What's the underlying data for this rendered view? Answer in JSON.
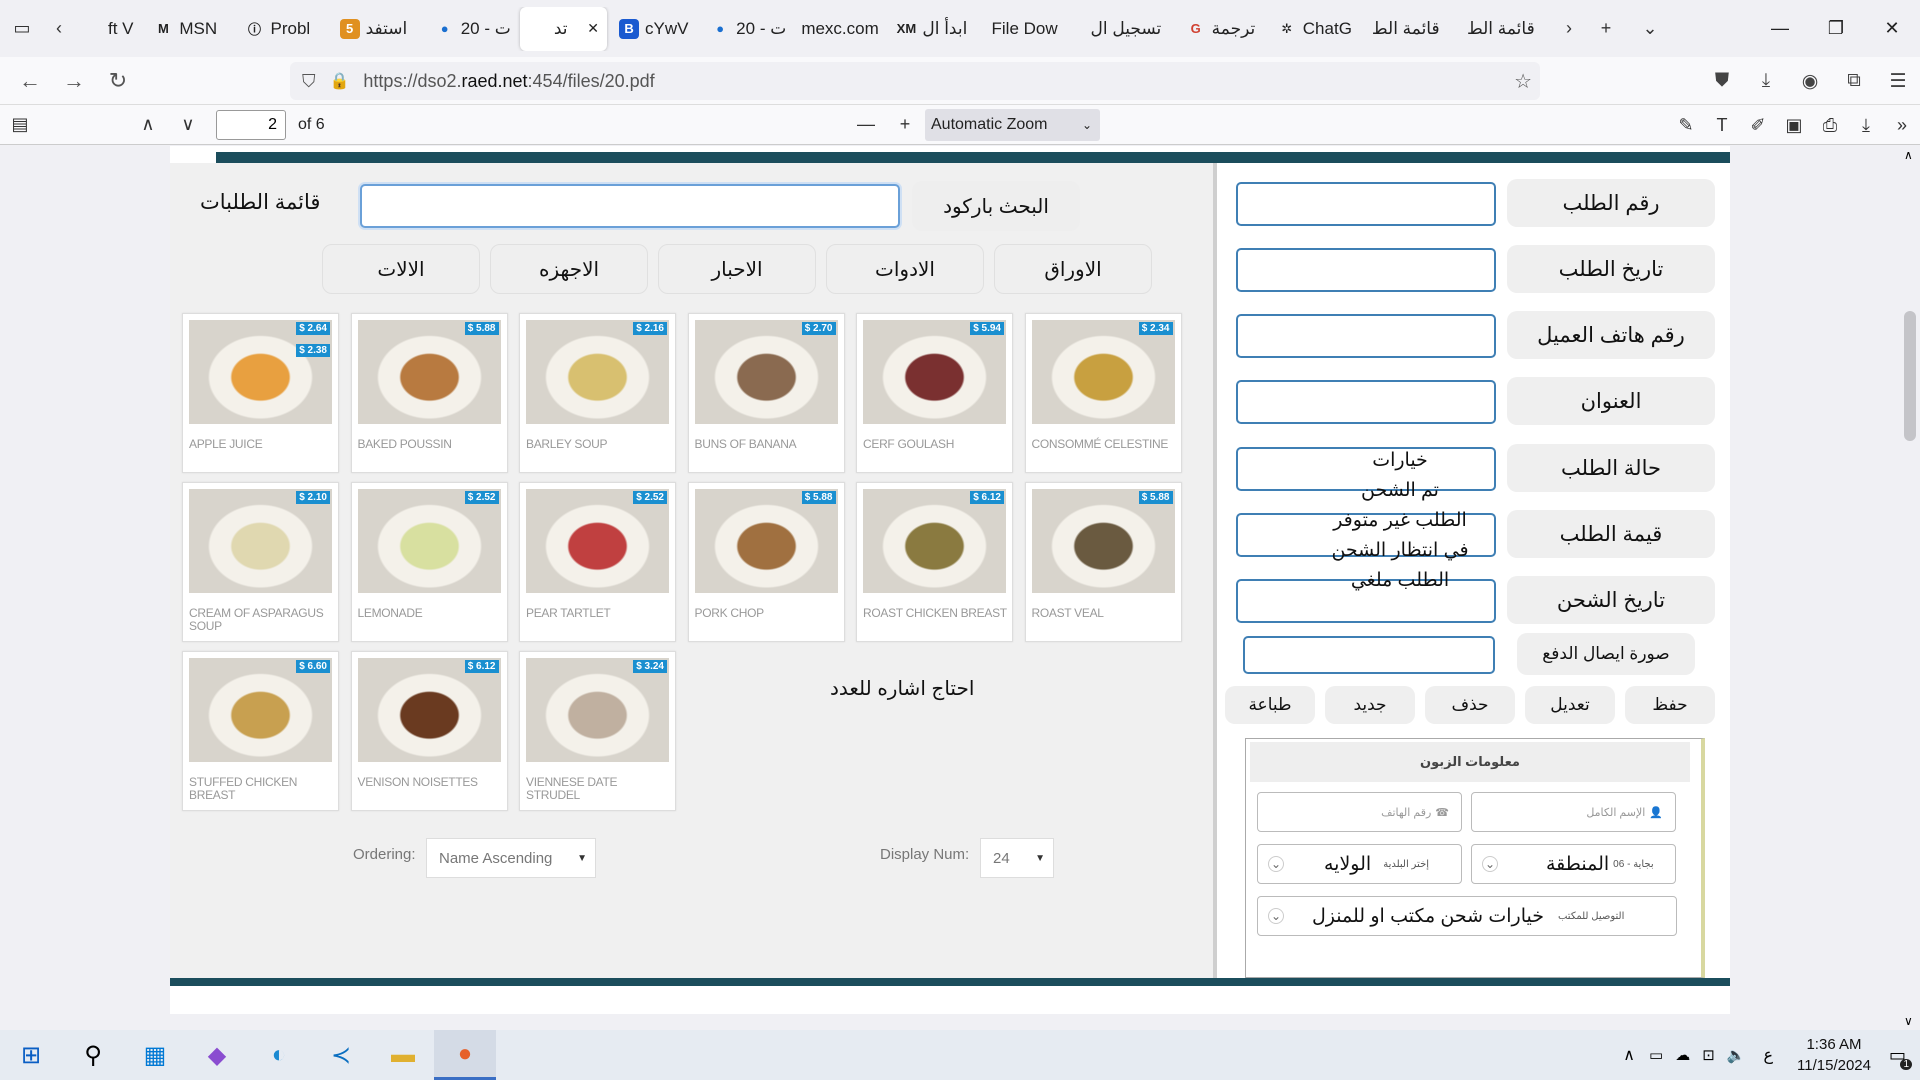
{
  "browser": {
    "tabs": [
      {
        "label": "ft V",
        "icon": "page-icon"
      },
      {
        "label": "MSN",
        "icon": "msn-icon"
      },
      {
        "label": "Probl",
        "icon": "info-icon"
      },
      {
        "label": "استفد",
        "icon": "number-5-icon"
      },
      {
        "label": "ت - 20",
        "icon": "cloud-icon"
      },
      {
        "label": "تد",
        "icon": "page-icon",
        "active": true
      },
      {
        "label": "cYwV",
        "icon": "b-icon"
      },
      {
        "label": "ت - 20",
        "icon": "cloud-icon"
      },
      {
        "label": "mexc.com",
        "icon": ""
      },
      {
        "label": "ابدأ ال",
        "icon": "xm-icon"
      },
      {
        "label": "File Dow",
        "icon": ""
      },
      {
        "label": "تسجيل ال",
        "icon": ""
      },
      {
        "label": "ترجمة",
        "icon": "google-icon"
      },
      {
        "label": "ChatG",
        "icon": "chatgpt-icon"
      },
      {
        "label": "قائمة الط",
        "icon": ""
      },
      {
        "label": "قائمة الط",
        "icon": ""
      }
    ],
    "url_prefix": "https://dso2.",
    "url_domain": "raed.net",
    "url_suffix": ":454/files/20.pdf"
  },
  "pdf_toolbar": {
    "page_number": "2",
    "page_count": "of 6",
    "zoom": "Automatic Zoom"
  },
  "form": {
    "list_title": "قائمة الطلبات",
    "barcode_search": "البحث باركود",
    "categories": [
      "الاوراق",
      "الادوات",
      "الاحبار",
      "الاجهزه",
      "الالات"
    ],
    "fields": [
      "رقم الطلب",
      "تاريخ الطلب",
      "رقم هاتف العميل",
      "العنوان",
      "حالة الطلب",
      "قيمة الطلب",
      "تاريخ الشحن",
      "صورة ايصال الدفع"
    ],
    "status_options": [
      "خيارات",
      "تم الشحن",
      "الطلب غير متوفر",
      "في انتظار الشحن",
      "الطلب ملغي"
    ],
    "actions": [
      "حفظ",
      "تعديل",
      "حذف",
      "جديد",
      "طباعة"
    ],
    "count_note": "احتاج اشاره للعدد"
  },
  "products": [
    {
      "name": "APPLE JUICE",
      "price": "$ 2.64",
      "price2": "$ 2.38",
      "color": "#e8a040"
    },
    {
      "name": "BAKED POUSSIN",
      "price": "$ 5.88",
      "color": "#b87a40"
    },
    {
      "name": "BARLEY SOUP",
      "price": "$ 2.16",
      "color": "#d8c070"
    },
    {
      "name": "BUNS OF BANANA",
      "price": "$ 2.70",
      "color": "#8a6a50"
    },
    {
      "name": "CERF GOULASH",
      "price": "$ 5.94",
      "color": "#7a3030"
    },
    {
      "name": "CONSOMMÉ CELESTINE",
      "price": "$ 2.34",
      "color": "#c8a040"
    },
    {
      "name": "CREAM OF ASPARAGUS SOUP",
      "price": "$ 2.10",
      "color": "#e0d8b0"
    },
    {
      "name": "LEMONADE",
      "price": "$ 2.52",
      "color": "#d8e0a0"
    },
    {
      "name": "PEAR TARTLET",
      "price": "$ 2.52",
      "color": "#c04040"
    },
    {
      "name": "PORK CHOP",
      "price": "$ 5.88",
      "color": "#a07040"
    },
    {
      "name": "ROAST CHICKEN BREAST",
      "price": "$ 6.12",
      "color": "#8a7a40"
    },
    {
      "name": "ROAST VEAL",
      "price": "$ 5.88",
      "color": "#6a5a40"
    },
    {
      "name": "STUFFED CHICKEN BREAST",
      "price": "$ 6.60",
      "color": "#c8a050"
    },
    {
      "name": "VENISON NOISETTES",
      "price": "$ 6.12",
      "color": "#6a3a20"
    },
    {
      "name": "VIENNESE DATE STRUDEL",
      "price": "$ 3.24",
      "color": "#c0b0a0"
    }
  ],
  "list_controls": {
    "ordering_label": "Ordering:",
    "ordering_value": "Name Ascending",
    "display_label": "Display Num:",
    "display_value": "24"
  },
  "customer": {
    "title": "معلومات الزبون",
    "full_name": "الإسم الكامل",
    "phone": "رقم الهاتف",
    "region_hint": "06 - بجاية",
    "region": "المنطقة",
    "city_hint": "إختر البلدية",
    "city": "الولايه",
    "shipping_hint": "التوصيل للمكتب",
    "shipping": "خيارات شحن مكتب او للمنزل"
  },
  "taskbar": {
    "time": "1:36 AM",
    "date": "11/15/2024",
    "lang": "ع",
    "notif_count": "1"
  }
}
